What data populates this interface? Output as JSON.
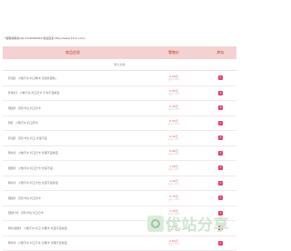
{
  "notice": "*客服请联系QQ:3116300634 欢迎您来 http://www.77ud.com/",
  "table": {
    "headers": {
      "name": "商品信息",
      "price": "零售价",
      "stock": "库存"
    },
    "category": "默认分类",
    "rows": [
      {
        "name": "【月度】 少数不许 抖卫单卡 无用处更新。",
        "price": "2.00元",
        "orig": "原价:4.00",
        "stock": "1"
      },
      {
        "name": "【【特价】 少数不许 抖卫日卡 不许不宜前宝",
        "price": "0.80元",
        "orig": "原价:2.00",
        "stock": "0"
      },
      {
        "name": "【更新】 高阶卡位 抖卫月卡",
        "price": "0.40元",
        "orig": "原价:2.00",
        "stock": "0"
      },
      {
        "name": "【周】 少数不许 抖卫周卡",
        "price": "0.50元",
        "orig": "原价:2.00",
        "stock": "1"
      },
      {
        "name": "【月度】 高阶卡位 抖卫 长度不宜",
        "price": "0.40元",
        "orig": "原价:2.00",
        "stock": "0"
      },
      {
        "name": "【特价】 少数不许 抖卫日卡 长期不宜前宝",
        "price": "0.40元",
        "orig": "原价:2.00",
        "stock": "1"
      },
      {
        "name": "【更新】 少数不许 抖卫日卡 长度不宜。",
        "price": "1.00元",
        "orig": "原价:2.00",
        "stock": "1"
      },
      {
        "name": "【特价】 少数不许 抖卫卡位 长度不宜前宝",
        "price": "1.00元",
        "orig": "原价:4.00",
        "stock": "1"
      },
      {
        "name": "【更新】 高阶卡位 抖卫月卡",
        "price": "0.70元",
        "orig": "原价:2.00",
        "stock": "1"
      },
      {
        "name": "【更新卡】 高阶卡位 抖卫日卡",
        "price": "1.20元",
        "orig": "原价:3.00",
        "stock": "1"
      },
      {
        "name": "【特价更新】 少数不许 抖卫 长期卡 长度不宜前宝",
        "price": "1.00元",
        "orig": "原价:2.00",
        "stock": "0"
      },
      {
        "name": "【特价】 少数不许 抖卫不许 长期卡 长期不宜前宝",
        "price": "0.60元",
        "orig": "原价:2.00",
        "stock": "1"
      }
    ]
  },
  "watermark": "优站分享",
  "colors": {
    "header_bg": "#f4d2d2",
    "accent": "#c0392b",
    "price": "#e45b3a",
    "badge": "#e8426b"
  }
}
